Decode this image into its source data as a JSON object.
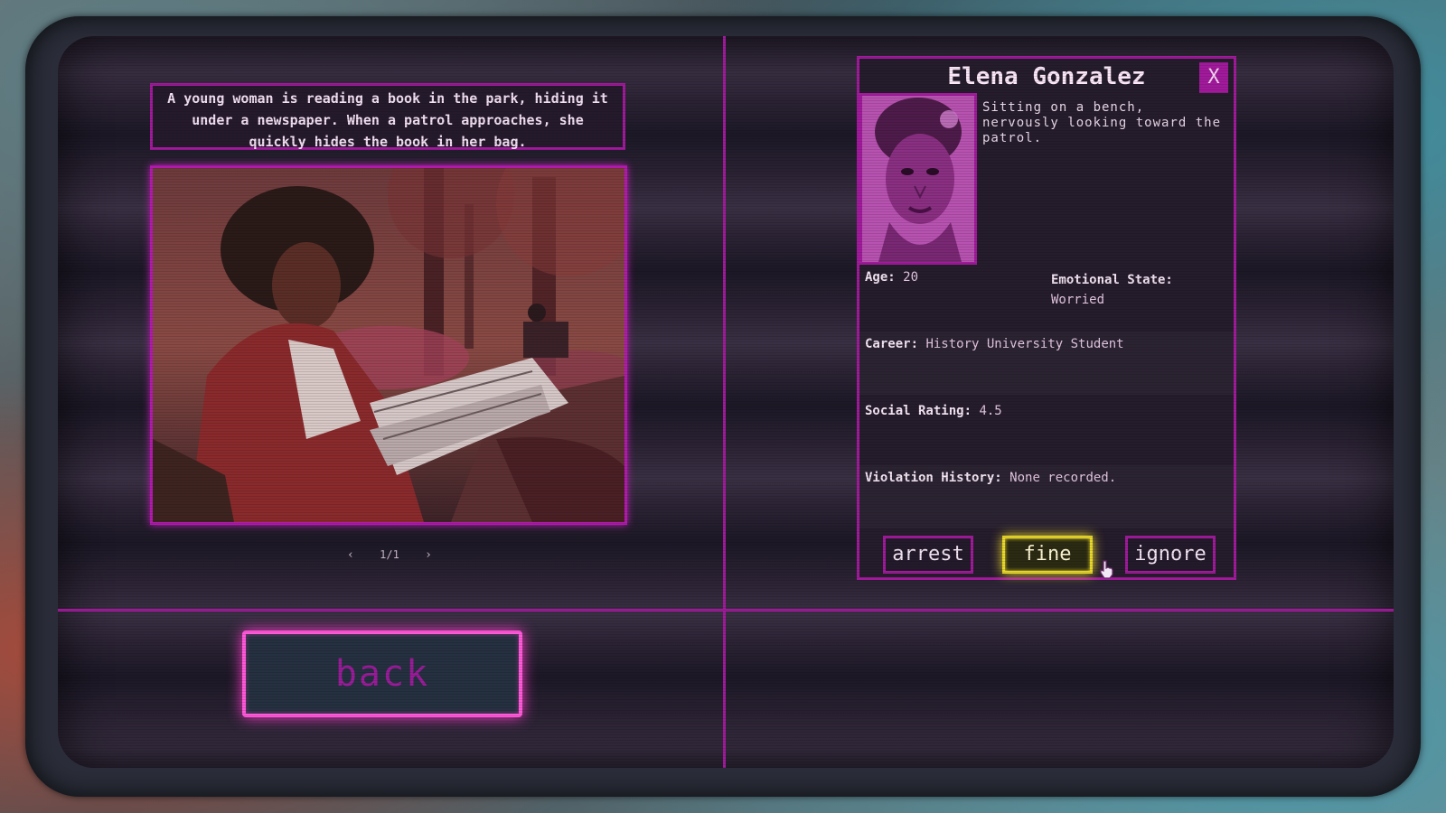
{
  "scene": {
    "description": "A young woman is reading a book in the park, hiding it under a newspaper. When a patrol approaches, she quickly hides the book in her bag.",
    "image_subject": "woman-reading-in-park",
    "pager": {
      "prev_icon": "chevron-left",
      "count": "1/1",
      "next_icon": "chevron-right"
    }
  },
  "back_button": {
    "label": "back"
  },
  "profile": {
    "name": "Elena Gonzalez",
    "close_label": "X",
    "portrait_icon": "portrait-woman",
    "description": "Sitting on a bench, nervously looking toward the patrol.",
    "age": {
      "label": "Age:",
      "value": "20"
    },
    "emotional_state": {
      "label": "Emotional State:",
      "value": "Worried"
    },
    "career": {
      "label": "Career:",
      "value": "History University Student"
    },
    "social_rating": {
      "label": "Social Rating:",
      "value": "4.5"
    },
    "violation_history": {
      "label": "Violation History:",
      "value": "None recorded."
    }
  },
  "actions": {
    "arrest": "arrest",
    "fine": "fine",
    "ignore": "ignore",
    "selected": "fine"
  },
  "colors": {
    "accent": "#a21a9c",
    "glow": "#ff58d8",
    "highlight": "#e8d82a"
  }
}
